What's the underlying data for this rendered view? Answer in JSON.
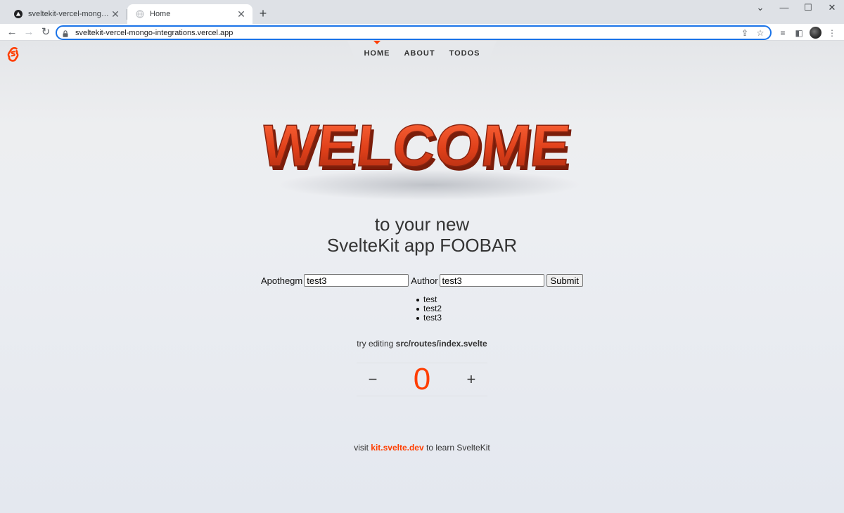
{
  "browser": {
    "tabs": [
      {
        "title": "sveltekit-vercel-mongo-integratio",
        "favicon": "vercel-triangle-icon"
      },
      {
        "title": "Home",
        "favicon": "globe-icon"
      }
    ],
    "url": "sveltekit-vercel-mongo-integrations.vercel.app"
  },
  "nav": {
    "items": [
      {
        "label": "HOME"
      },
      {
        "label": "ABOUT"
      },
      {
        "label": "TODOS"
      }
    ]
  },
  "hero": {
    "welcome_text": "WELCOME",
    "heading_line1": "to your new",
    "heading_line2": "SvelteKit app FOOBAR"
  },
  "form": {
    "apothegm_label": "Apothegm",
    "apothegm_value": "test3",
    "author_label": "Author",
    "author_value": "test3",
    "submit_label": "Submit"
  },
  "quotes": [
    "test",
    "test2",
    "test3"
  ],
  "hint": {
    "prefix": "try editing",
    "path": "src/routes/index.svelte"
  },
  "counter": {
    "decrement": "−",
    "value": "0",
    "increment": "+"
  },
  "footer": {
    "prefix": "visit",
    "link": "kit.svelte.dev",
    "suffix": "to learn SvelteKit"
  },
  "colors": {
    "accent": "#ff3e00",
    "omnibox_focus": "#1a73e8"
  }
}
